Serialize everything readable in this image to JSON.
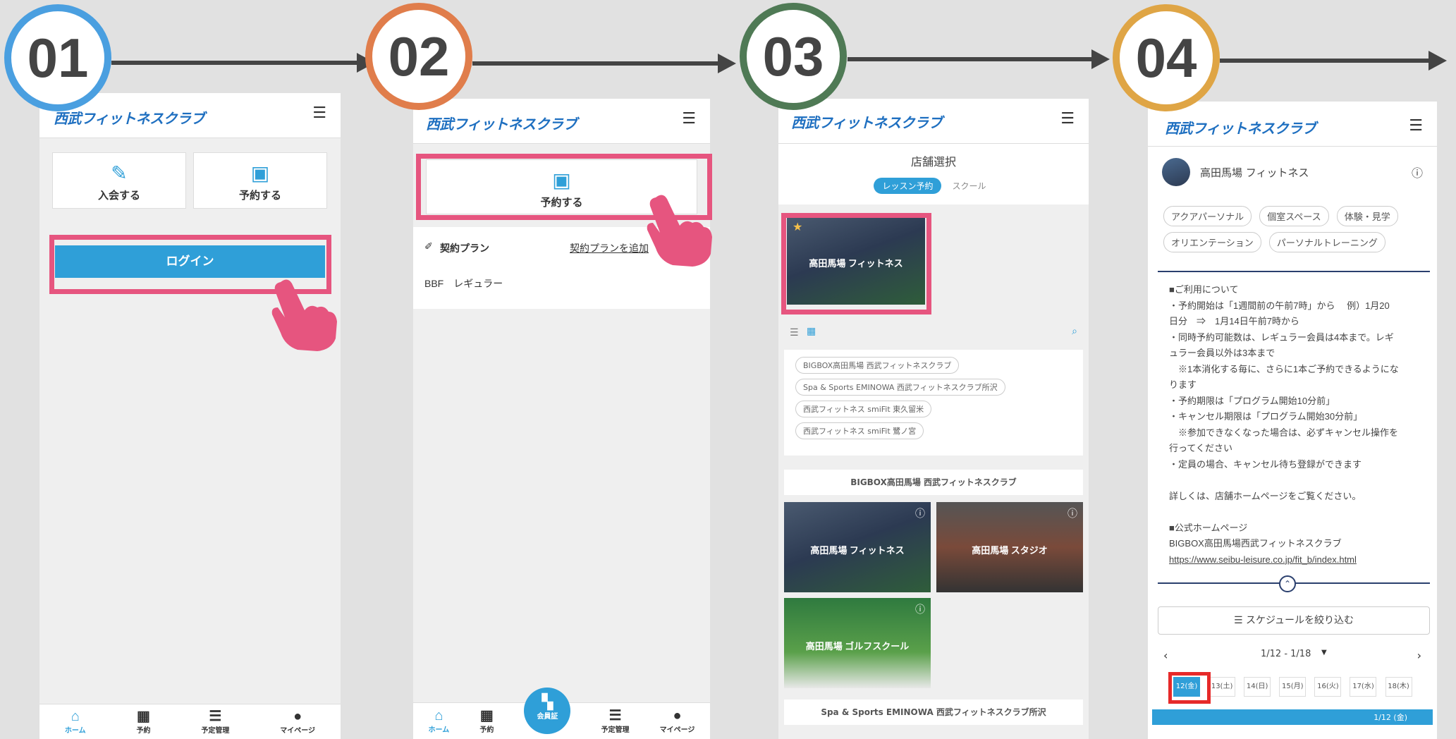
{
  "steps": [
    {
      "number": "01",
      "color": "#4a9fe0"
    },
    {
      "number": "02",
      "color": "#e07d4b"
    },
    {
      "number": "03",
      "color": "#4f7a55"
    },
    {
      "number": "04",
      "color": "#dfa545"
    }
  ],
  "app": {
    "logo": "西武フィットネスクラブ",
    "menu_icon": "hamburger-icon"
  },
  "screen1": {
    "cards": [
      {
        "label": "入会する",
        "icon": "pencil-icon"
      },
      {
        "label": "予約する",
        "icon": "calendar-check-icon"
      }
    ],
    "login_button": "ログイン"
  },
  "screen2": {
    "reserve_label": "予約する",
    "contract_title": "契約プラン",
    "contract_link": "契約プランを追加",
    "plan_name": "BBF　レギュラー",
    "nav": [
      {
        "label": "ホーム",
        "icon": "home-icon"
      },
      {
        "label": "予約",
        "icon": "calendar-icon"
      },
      {
        "label": "会員証",
        "icon": "qr-icon"
      },
      {
        "label": "予定管理",
        "icon": "list-icon"
      },
      {
        "label": "マイページ",
        "icon": "user-icon"
      }
    ]
  },
  "screen1_nav": [
    {
      "label": "ホーム",
      "icon": "home-icon"
    },
    {
      "label": "予約",
      "icon": "calendar-icon"
    },
    {
      "label": "予定管理",
      "icon": "list-icon"
    },
    {
      "label": "マイページ",
      "icon": "user-icon"
    }
  ],
  "screen3": {
    "title": "店舗選択",
    "tab_active": "レッスン予約",
    "tab_other": "スクール",
    "featured_caption": "高田馬場 フィットネス",
    "tags": [
      "BIGBOX高田馬場 西武フィットネスクラブ",
      "Spa & Sports EMINOWA 西武フィットネスクラブ所沢",
      "西武フィットネス smiFit 東久留米",
      "西武フィットネス smiFit 鷺ノ宮"
    ],
    "section1": "BIGBOX高田馬場 西武フィットネスクラブ",
    "tiles": [
      "高田馬場 フィットネス",
      "高田馬場 スタジオ",
      "高田馬場 ゴルフスクール"
    ],
    "section2": "Spa & Sports EMINOWA 西武フィットネスクラブ所沢"
  },
  "screen4": {
    "store_name": "高田馬場 フィットネス",
    "pills": [
      "アクアパーソナル",
      "個室スペース",
      "体験・見学",
      "オリエンテーション",
      "パーソナルトレーニング"
    ],
    "info_lines": [
      "■ご利用について",
      "・予約開始は「1週間前の午前7時」から　 例）1月20",
      "日分　⇒　1月14日午前7時から",
      "・同時予約可能数は、レギュラー会員は4本まで。レギ",
      "ュラー会員以外は3本まで",
      "　※1本消化する毎に、さらに1本ご予約できるようにな",
      "ります",
      "・予約期限は「プログラム開始10分前」",
      "・キャンセル期限は「プログラム開始30分前」",
      "　※参加できなくなった場合は、必ずキャンセル操作を",
      "行ってください",
      "・定員の場合、キャンセル待ち登録ができます",
      "",
      "詳しくは、店舗ホームページをご覧ください。",
      "",
      "■公式ホームページ",
      "BIGBOX高田馬場西武フィットネスクラブ"
    ],
    "link": "https://www.seibu-leisure.co.jp/fit_b/index.html",
    "filter_button": "スケジュールを絞り込む",
    "week_range": "1/12 - 1/18",
    "days": [
      "12(金)",
      "13(土)",
      "14(日)",
      "15(月)",
      "16(火)",
      "17(水)",
      "18(木)"
    ],
    "date_bar": "1/12 (金)"
  }
}
